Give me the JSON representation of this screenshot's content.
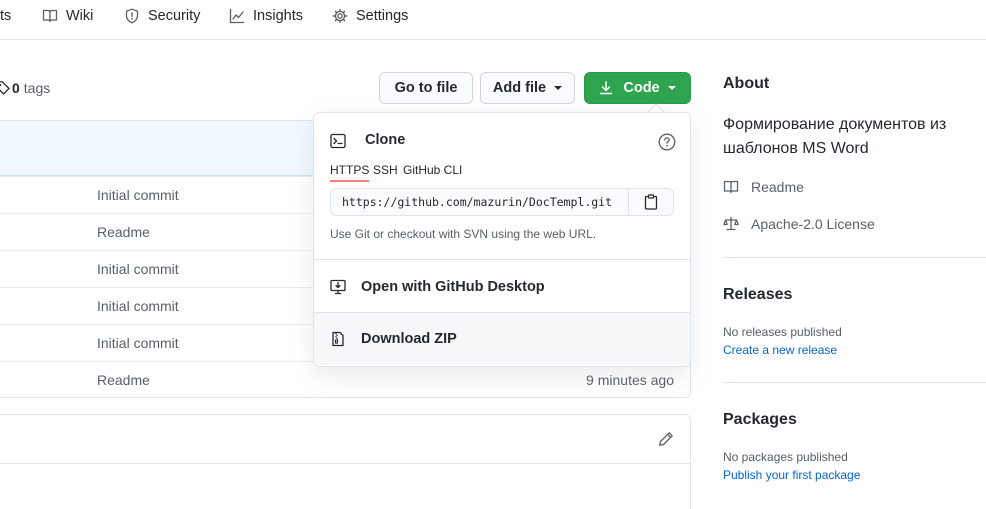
{
  "nav": {
    "partial_tab": "ts",
    "wiki": "Wiki",
    "security": "Security",
    "insights": "Insights",
    "settings": "Settings"
  },
  "tags": {
    "count": "0",
    "label": "tags"
  },
  "buttons": {
    "go_to_file": "Go to file",
    "add_file": "Add file",
    "code": "Code"
  },
  "files": [
    {
      "message": "Initial commit",
      "time": ""
    },
    {
      "message": "Readme",
      "time": ""
    },
    {
      "message": "Initial commit",
      "time": ""
    },
    {
      "message": "Initial commit",
      "time": ""
    },
    {
      "message": "Initial commit",
      "time": ""
    },
    {
      "message": "Readme",
      "time": "9 minutes ago"
    }
  ],
  "clone": {
    "title": "Clone",
    "tabs": [
      "HTTPS",
      "SSH",
      "GitHub CLI"
    ],
    "active_tab": "HTTPS",
    "url": "https://github.com/mazurin/DocTempl.git",
    "note": "Use Git or checkout with SVN using the web URL.",
    "open_desktop": "Open with GitHub Desktop",
    "download_zip": "Download ZIP"
  },
  "sidebar": {
    "about_title": "About",
    "description": "Формирование документов из шаблонов MS Word",
    "readme": "Readme",
    "license": "Apache-2.0 License",
    "releases_title": "Releases",
    "releases_none": "No releases published",
    "releases_create": "Create a new release",
    "packages_title": "Packages",
    "packages_none": "No packages published",
    "packages_publish": "Publish your first package"
  },
  "colors": {
    "accent_green": "#2ea44f",
    "link_blue": "#0366d6",
    "tab_underline": "#f9826c",
    "muted_text": "#586069",
    "border": "#e1e4e8"
  },
  "icons": {
    "wiki": "book-icon",
    "security": "shield-icon",
    "insights": "graph-icon",
    "settings": "gear-icon",
    "tags": "tag-icon",
    "code": "download-icon",
    "clone": "terminal-icon",
    "help": "question-icon",
    "copy": "clipboard-icon",
    "desktop": "desktop-download-icon",
    "zip": "file-zip-icon",
    "readme": "book-icon",
    "license": "law-icon",
    "edit": "pencil-icon"
  }
}
